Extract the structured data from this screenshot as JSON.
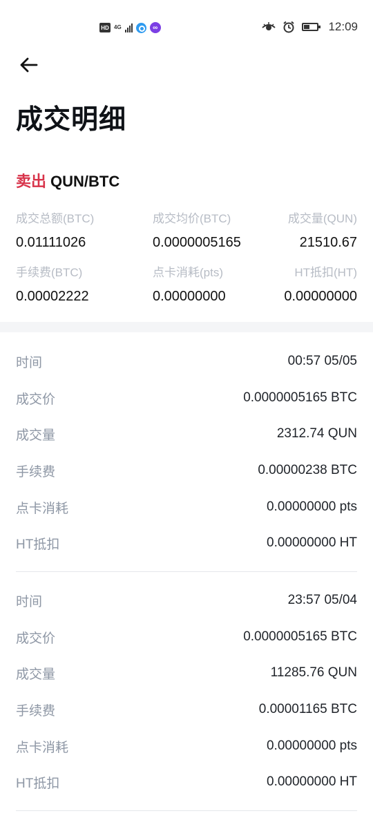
{
  "status_bar": {
    "left_icons": [
      "hd-icon",
      "signal-4g-icon",
      "app-notification-icon",
      "app-chat-icon"
    ],
    "network": "4G",
    "hd": "HD",
    "right_icons": [
      "eye-icon",
      "alarm-icon",
      "battery-icon"
    ],
    "time": "12:09"
  },
  "header": {
    "title": "成交明细"
  },
  "order": {
    "side": "卖出",
    "symbol": "QUN/BTC",
    "side_color": "#d8334a"
  },
  "summary": [
    {
      "label": "成交总额(BTC)",
      "value": "0.01111026"
    },
    {
      "label": "成交均价(BTC)",
      "value": "0.0000005165"
    },
    {
      "label": "成交量(QUN)",
      "value": "21510.67"
    },
    {
      "label": "手续费(BTC)",
      "value": "0.00002222"
    },
    {
      "label": "点卡消耗(pts)",
      "value": "0.00000000"
    },
    {
      "label": "HT抵扣(HT)",
      "value": "0.00000000"
    }
  ],
  "trades": [
    {
      "rows": [
        {
          "label": "时间",
          "value": "00:57 05/05"
        },
        {
          "label": "成交价",
          "value": "0.0000005165 BTC"
        },
        {
          "label": "成交量",
          "value": "2312.74 QUN"
        },
        {
          "label": "手续费",
          "value": "0.00000238 BTC"
        },
        {
          "label": "点卡消耗",
          "value": "0.00000000 pts"
        },
        {
          "label": "HT抵扣",
          "value": "0.00000000 HT"
        }
      ]
    },
    {
      "rows": [
        {
          "label": "时间",
          "value": "23:57 05/04"
        },
        {
          "label": "成交价",
          "value": "0.0000005165 BTC"
        },
        {
          "label": "成交量",
          "value": "11285.76 QUN"
        },
        {
          "label": "手续费",
          "value": "0.00001165 BTC"
        },
        {
          "label": "点卡消耗",
          "value": "0.00000000 pts"
        },
        {
          "label": "HT抵扣",
          "value": "0.00000000 HT"
        }
      ]
    }
  ]
}
